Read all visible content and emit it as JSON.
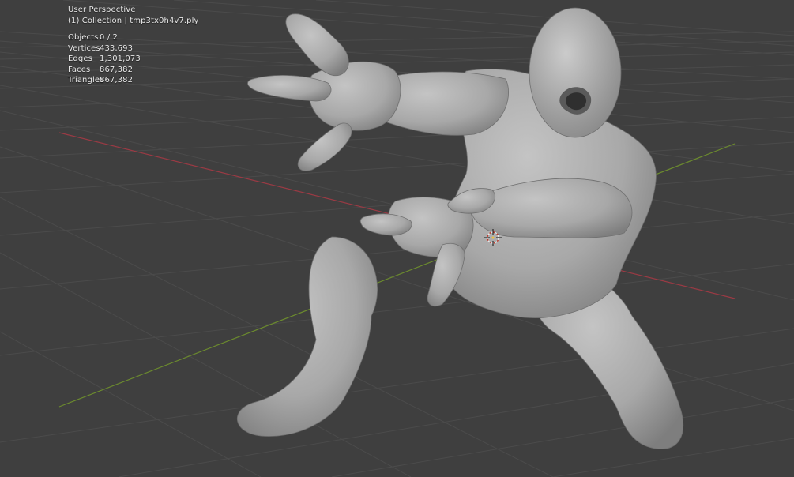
{
  "viewport": {
    "view_name": "User Perspective",
    "collection_line": "(1) Collection | tmp3tx0h4v7.ply",
    "stats": [
      {
        "label": "Objects",
        "value": "0 / 2"
      },
      {
        "label": "Vertices",
        "value": "433,693"
      },
      {
        "label": "Edges",
        "value": "1,301,073"
      },
      {
        "label": "Faces",
        "value": "867,382"
      },
      {
        "label": "Triangles",
        "value": "867,382"
      }
    ]
  },
  "colors": {
    "background": "#3f3f3f",
    "grid": "#4a4a4a",
    "x_axis": "#9a3a44",
    "y_axis": "#6b8a2e",
    "model": "#a9a9a9",
    "cursor": "#e0e0e0"
  }
}
